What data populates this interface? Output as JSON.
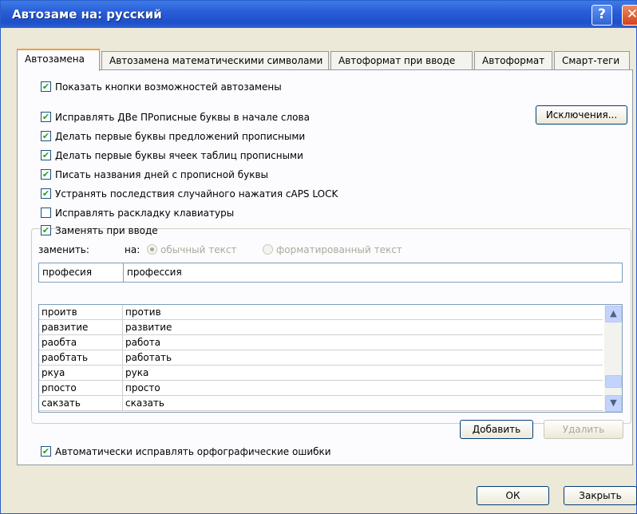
{
  "window": {
    "title": "Автозаме на: русский"
  },
  "tabs": [
    {
      "label": "Автозамена",
      "active": true
    },
    {
      "label": "Автозамена математическими символами"
    },
    {
      "label": "Автоформат при вводе"
    },
    {
      "label": "Автоформат"
    },
    {
      "label": "Смарт-теги"
    }
  ],
  "options": {
    "show_buttons": "Показать кнопки возможностей автозамены",
    "two_caps": "Исправлять ДВе ПРописные буквы в начале слова",
    "first_letter_sentence": "Делать первые буквы предложений прописными",
    "first_letter_cells": "Делать первые буквы ячеек таблиц прописными",
    "day_names": "Писать названия дней с прописной буквы",
    "caps_lock": "Устранять последствия случайного нажатия cAPS LOCK",
    "keyboard_layout": "Исправлять раскладку клавиатуры",
    "replace_as_type": "Заменять при вводе",
    "spelling": "Автоматически исправлять орфографические ошибки"
  },
  "buttons": {
    "exceptions": "Исключения...",
    "add": "Добавить",
    "delete": "Удалить",
    "ok": "ОК",
    "close": "Закрыть"
  },
  "replace": {
    "replace_label": "заменить:",
    "with_label": "на:",
    "plain_text": "обычный текст",
    "formatted_text": "форматированный текст",
    "replace_value": "професия",
    "with_value": "профессия"
  },
  "entries": [
    {
      "from": "проитв",
      "to": "против"
    },
    {
      "from": "равзитие",
      "to": "развитие"
    },
    {
      "from": "раобта",
      "to": "работа"
    },
    {
      "from": "раобтать",
      "to": "работать"
    },
    {
      "from": "ркуа",
      "to": "рука"
    },
    {
      "from": "рпосто",
      "to": "просто"
    },
    {
      "from": "сакзать",
      "to": "сказать"
    }
  ],
  "colors": {
    "titlebar": "#2a5ed8",
    "check": "#21a121",
    "tab_highlight": "#f0a03c"
  }
}
